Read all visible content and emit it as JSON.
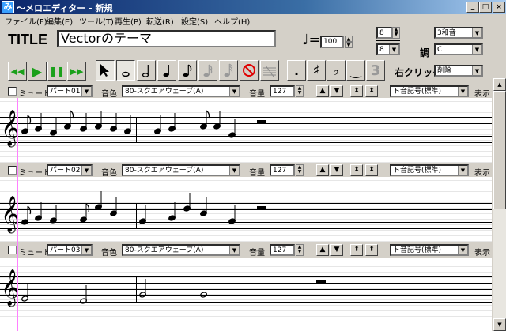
{
  "window": {
    "title": "～メロエディター - 新規",
    "min": "_",
    "max": "□",
    "close": "×"
  },
  "menu": [
    "ファイル(F)",
    "編集(E)",
    "ツール(T)",
    "再生(P)",
    "転送(R)",
    "設定(S)",
    "ヘルプ(H)"
  ],
  "song": {
    "title_label": "TITLE",
    "title": "Vectorのテーマ",
    "tempo_symbol": "♩=",
    "tempo": "100",
    "time_sig_num": "8",
    "time_sig_den": "8",
    "harmony": "3和音",
    "key_label": "調",
    "key": "C",
    "rightclick_label": "右クリック",
    "rightclick_action": "削除"
  },
  "toolbar": {
    "rewind": "◀◀",
    "play": "▶",
    "pause": "❚❚",
    "forward": "▶▶",
    "dot": ".",
    "sharp": "♯",
    "flat": "♭",
    "tie": "‿",
    "triplet": "3"
  },
  "parts": [
    {
      "mute_label": "ミュート",
      "part": "パート01",
      "tone_label": "音色",
      "tone": "80-スクエアウェーブ(A)",
      "vol_label": "音量",
      "volume": "127",
      "clef": "ト音記号(標準)",
      "show_label": "表示"
    },
    {
      "mute_label": "ミュート",
      "part": "パート02",
      "tone_label": "音色",
      "tone": "80-スクエアウェーブ(A)",
      "vol_label": "音量",
      "volume": "127",
      "clef": "ト音記号(標準)",
      "show_label": "表示"
    },
    {
      "mute_label": "ミュート",
      "part": "パート03",
      "tone_label": "音色",
      "tone": "80-スクエアウェーブ(A)",
      "vol_label": "音量",
      "volume": "127",
      "clef": "ト音記号(標準)",
      "show_label": "表示"
    }
  ],
  "glyphs": {
    "clef": "𝄞",
    "rest": "𝄼",
    "arrow_up": "▲",
    "arrow_down": "▼",
    "up_down": "⬍",
    "dd": "▼",
    "spin_up": "▲",
    "spin_down": "▼"
  }
}
